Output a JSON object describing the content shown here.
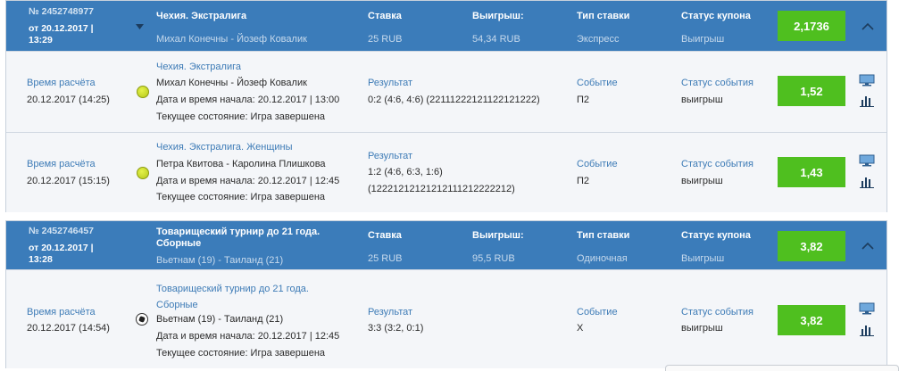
{
  "labels": {
    "stake": "Ставка",
    "winnings": "Выигрыш:",
    "bet_type": "Тип ставки",
    "coupon_status": "Статус купона",
    "calc_time": "Время расчёта",
    "result": "Результат",
    "event": "Событие",
    "event_status": "Статус события",
    "collapse_glyph": "⌃"
  },
  "coupons": [
    {
      "number": "№ 2452748977",
      "date": "от 20.12.2017 | 13:29",
      "title": "Чехия. Экстралига",
      "subtitle": "Михал Конечны - Йозеф Ковалик",
      "stake": "25 RUB",
      "winnings": "54,34 RUB",
      "bet_type": "Экспресс",
      "coupon_status": "Выигрыш",
      "odds": "2,1736",
      "events": [
        {
          "calc_time": "20.12.2017 (14:25)",
          "sport_icon": "tennis-ball-icon",
          "league": "Чехия. Экстралига",
          "match": "Михал Конечны - Йозеф Ковалик",
          "start": "Дата и время начала: 20.12.2017 | 13:00",
          "state": "Текущее состояние: Игра завершена",
          "score_lines": [
            "0:2 (4:6, 4:6) (22111222121122121222)"
          ],
          "outcome": "П2",
          "status": "выигрыш",
          "odds": "1,52"
        },
        {
          "calc_time": "20.12.2017 (15:15)",
          "sport_icon": "tennis-ball-icon",
          "league": "Чехия. Экстралига. Женщины",
          "match": "Петра Квитова - Каролина Плишкова",
          "start": "Дата и время начала: 20.12.2017 | 12:45",
          "state": "Текущее состояние: Игра завершена",
          "score_lines": [
            "1:2 (4:6, 6:3, 1:6)",
            "(12221212121212111212222212)"
          ],
          "outcome": "П2",
          "status": "выигрыш",
          "odds": "1,43"
        }
      ]
    },
    {
      "number": "№ 2452746457",
      "date": "от 20.12.2017 | 13:28",
      "title": "Товарищеский турнир до 21 года. Сборные",
      "subtitle": "Вьетнам (19) - Таиланд (21)",
      "stake": "25 RUB",
      "winnings": "95,5 RUB",
      "bet_type": "Одиночная",
      "coupon_status": "Выигрыш",
      "odds": "3,82",
      "events": [
        {
          "calc_time": "20.12.2017 (14:54)",
          "sport_icon": "soccer-ball-icon",
          "league": "Товарищеский турнир до 21 года. Сборные",
          "match": "Вьетнам (19) - Таиланд (21)",
          "start": "Дата и время начала: 20.12.2017 | 12:45",
          "state": "Текущее состояние: Игра завершена",
          "score_lines": [
            "3:3 (3:2, 0:1)"
          ],
          "outcome": "Х",
          "status": "выигрыш",
          "odds": "3,82"
        }
      ]
    }
  ]
}
